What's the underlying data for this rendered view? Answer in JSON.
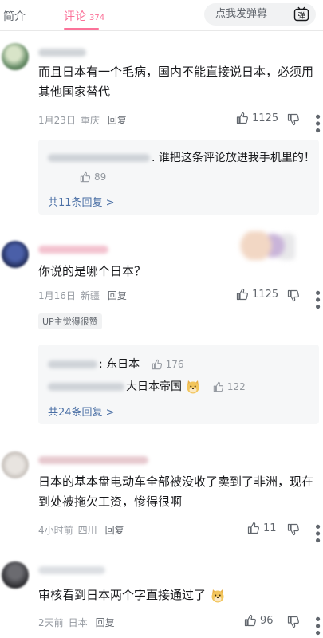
{
  "tabs": [
    {
      "label": "简介"
    },
    {
      "label": "评论",
      "count": "374"
    }
  ],
  "danmu": {
    "placeholder": "点我发弹幕",
    "icon_label": "弹"
  },
  "comments": [
    {
      "text": "而且日本有一个毛病，国内不能直接说日本，必须用其他国家替代",
      "date": "1月23日",
      "location": "重庆",
      "reply": "回复",
      "likes": "1125",
      "sub_replies": [
        {
          "text": ". 谁把这条评论放进我手机里的！",
          "likes": "89"
        }
      ],
      "view_all": "共11条回复 >"
    },
    {
      "text": "你说的是哪个日本？",
      "date": "1月16日",
      "location": "新疆",
      "reply": "回复",
      "likes": "1125",
      "badge": "UP主觉得很赞",
      "sub_replies": [
        {
          "text": ": 东日本",
          "likes": "176"
        },
        {
          "text": "大日本帝国",
          "likes": "122"
        }
      ],
      "view_all": "共24条回复 >"
    },
    {
      "text": "日本的基本盘电动车全部被没收了卖到了非洲，现在到处被拖欠工资，惨得很啊",
      "date": "4小时前",
      "location": "四川",
      "reply": "回复",
      "likes": "11"
    },
    {
      "text": "审核看到日本两个字直接通过了",
      "date": "2天前",
      "location": "日本",
      "reply": "回复",
      "likes": "96"
    }
  ],
  "colors": {
    "accent": "#fb7299",
    "link": "#4a6fa5",
    "meta": "#9499a0"
  },
  "icons": [
    "thumb-up-icon",
    "thumb-down-icon",
    "more-icon",
    "danmu-icon",
    "doge-emoji"
  ]
}
